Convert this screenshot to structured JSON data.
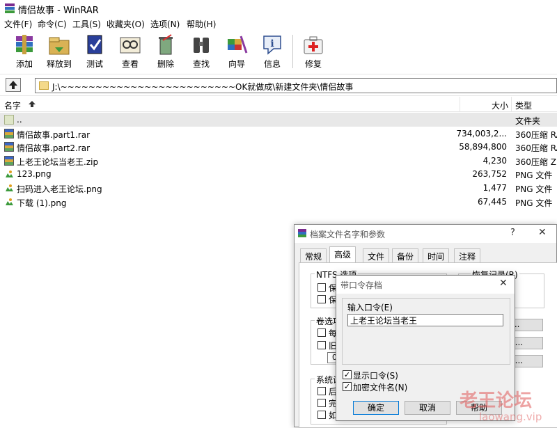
{
  "window": {
    "title": "情侣故事 - WinRAR"
  },
  "menu": [
    "文件(F)",
    "命令(C)",
    "工具(S)",
    "收藏夹(O)",
    "选项(N)",
    "帮助(H)"
  ],
  "toolbar": [
    {
      "label": "添加",
      "icon": "add-icon"
    },
    {
      "label": "释放到",
      "icon": "extract-icon"
    },
    {
      "label": "测试",
      "icon": "test-icon"
    },
    {
      "label": "查看",
      "icon": "view-icon"
    },
    {
      "label": "删除",
      "icon": "delete-icon"
    },
    {
      "label": "查找",
      "icon": "find-icon"
    },
    {
      "label": "向导",
      "icon": "wizard-icon"
    },
    {
      "label": "信息",
      "icon": "info-icon"
    },
    {
      "label": "修复",
      "icon": "repair-icon"
    }
  ],
  "address": {
    "path": "J:\\~~~~~~~~~~~~~~~~~~~~~~~~~OK就做成\\新建文件夹\\情侣故事"
  },
  "columns": {
    "name": "名字",
    "size": "大小",
    "type": "类型"
  },
  "files": [
    {
      "name": "..",
      "size": "",
      "type": "文件夹",
      "kind": "up"
    },
    {
      "name": "情侣故事.part1.rar",
      "size": "734,003,2...",
      "type": "360压缩 RA",
      "kind": "rar"
    },
    {
      "name": "情侣故事.part2.rar",
      "size": "58,894,800",
      "type": "360压缩 RA",
      "kind": "rar"
    },
    {
      "name": "上老王论坛当老王.zip",
      "size": "4,230",
      "type": "360压缩 ZIP",
      "kind": "rar"
    },
    {
      "name": "123.png",
      "size": "263,752",
      "type": "PNG 文件",
      "kind": "png"
    },
    {
      "name": "扫码进入老王论坛.png",
      "size": "1,477",
      "type": "PNG 文件",
      "kind": "png"
    },
    {
      "name": "下载 (1).png",
      "size": "67,445",
      "type": "PNG 文件",
      "kind": "png"
    }
  ],
  "archive_dialog": {
    "title": "档案文件名字和参数",
    "help_glyph": "?",
    "close_glyph": "✕",
    "tabs": [
      "常规",
      "高级",
      "文件",
      "备份",
      "时间",
      "注释"
    ],
    "active_tab": "高级",
    "ntfs_group": "NTFS 选项",
    "ntfs_items": [
      "保",
      "保"
    ],
    "recovery_group": "恢复记录(R)",
    "volume_group": "卷选项",
    "volume_items": [
      "每",
      "旧"
    ],
    "volume_value": "0",
    "system_group": "系统设",
    "system_items": [
      "后",
      "完",
      "如"
    ],
    "btn_partial_1": "...",
    "btn_partial_2": ")...",
    "btn_partial_3": ")..."
  },
  "password_dialog": {
    "title": "带口令存档",
    "close_glyph": "✕",
    "label": "输入口令(E)",
    "value": "上老王论坛当老王",
    "show_password": {
      "label": "显示口令(S)",
      "checked": true
    },
    "encrypt_names": {
      "label": "加密文件名(N)",
      "checked": true
    },
    "buttons": {
      "ok": "确定",
      "cancel": "取消",
      "help": "帮助"
    }
  },
  "watermark": {
    "text": "老王论坛",
    "url": "laowang.vip"
  }
}
